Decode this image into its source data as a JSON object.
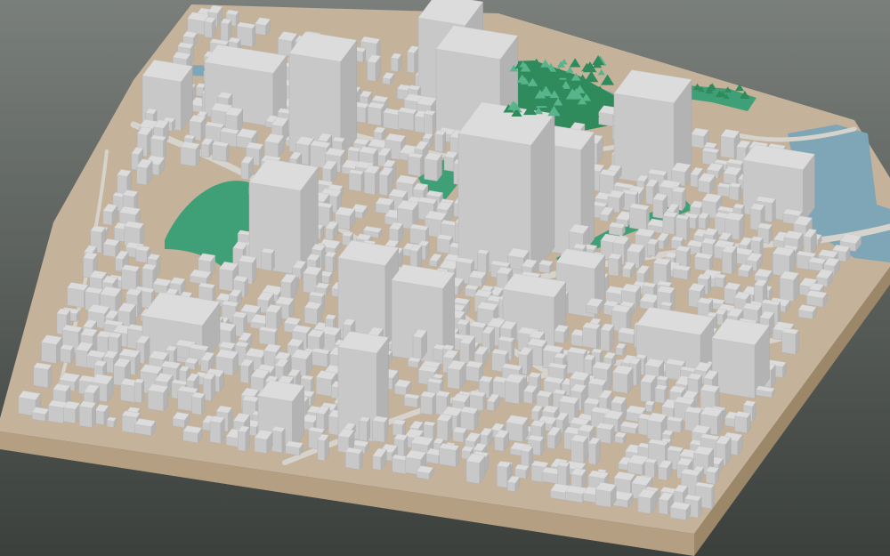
{
  "scene": {
    "description_visible_text": "",
    "colors": {
      "background_top": "#7a7f7b",
      "background_bottom": "#3b403d",
      "terrain": "#c4b29a",
      "terrain_dark": "#a8957c",
      "base_side": "#b59f82",
      "base_side_dark": "#9c8769",
      "building_top": "#dcdcdc",
      "building_left": "#c8c8c8",
      "building_right": "#b3b3b3",
      "road": "#d6d3cc",
      "park": "#3f9f77",
      "park_light": "#58b48a",
      "trees": "#2f8a5c",
      "water": "#7fa6b6"
    },
    "model": "3d-city-block-model"
  }
}
